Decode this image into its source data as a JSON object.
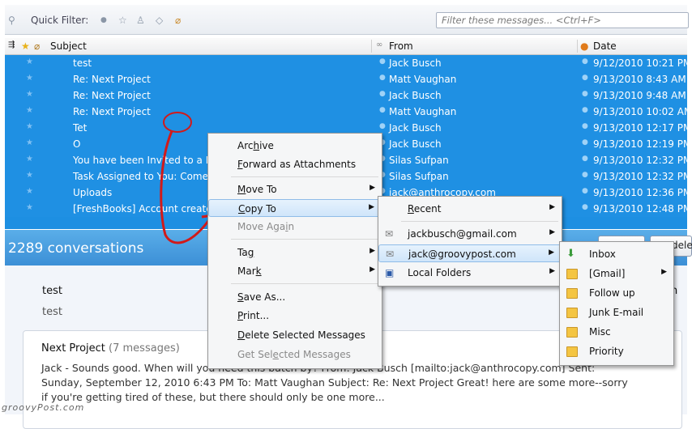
{
  "quick_filter": {
    "label": "Quick Filter:",
    "placeholder": "Filter these messages... <Ctrl+F>",
    "icons": [
      "pin-icon",
      "unread-icon",
      "star-icon",
      "contact-icon",
      "tag-icon",
      "attachment-icon"
    ]
  },
  "columns": {
    "subject": "Subject",
    "from": "From",
    "date": "Date"
  },
  "messages": [
    {
      "subject": "test",
      "from": "Jack Busch",
      "date": "9/12/2010 10:21 PM"
    },
    {
      "subject": "Re: Next Project",
      "from": "Matt Vaughan",
      "date": "9/13/2010 8:43 AM"
    },
    {
      "subject": "Re: Next Project",
      "from": "Jack Busch",
      "date": "9/13/2010 9:48 AM"
    },
    {
      "subject": "Re: Next Project",
      "from": "Matt Vaughan",
      "date": "9/13/2010 10:02 AM"
    },
    {
      "subject": "Tet",
      "from": "Jack Busch",
      "date": "9/13/2010 12:17 PM"
    },
    {
      "subject": "O",
      "from": "Jack Busch",
      "date": "9/13/2010 12:19 PM"
    },
    {
      "subject": "You have been Invited to a P",
      "from": "Silas Sufpan",
      "date": "9/13/2010 12:32 PM"
    },
    {
      "subject": "Task Assigned to You: Come",
      "from": "Silas Sufpan",
      "date": "9/13/2010 12:32 PM"
    },
    {
      "subject": "Uploads",
      "from": "jack@anthrocopy.com",
      "date": "9/13/2010 12:36 PM"
    },
    {
      "subject": "[FreshBooks] Account create",
      "from": "Jack Busch",
      "date": "9/13/2010 12:48 PM"
    }
  ],
  "conversation": {
    "count_label": "2289 conversations",
    "button_fragment": "delet"
  },
  "preview": {
    "subject1": "test",
    "body1": "test",
    "trailing_letter": "h",
    "thread_title": "Next Project",
    "thread_count": "(7 messages)",
    "lines": [
      "Jack - Sounds good. When will you need this batch by? From: Jack Busch [mailto:jack@anthrocopy.com] Sent:",
      "Sunday, September 12, 2010 6:43 PM To: Matt Vaughan Subject: Re: Next Project Great! here are some more--sorry",
      "if you're getting tired of these, but there should only be one more..."
    ]
  },
  "context_menu": {
    "archive": {
      "pre": "Arc",
      "u": "h",
      "post": "ive"
    },
    "forward": {
      "pre": "",
      "u": "F",
      "post": "orward as Attachments"
    },
    "move_to": {
      "pre": "",
      "u": "M",
      "post": "ove To"
    },
    "copy_to": {
      "pre": "",
      "u": "C",
      "post": "opy To"
    },
    "move_again": {
      "pre": "Move Aga",
      "u": "i",
      "post": "n"
    },
    "tag": {
      "pre": "Ta",
      "u": "g",
      "post": ""
    },
    "mark": {
      "pre": "Mar",
      "u": "k",
      "post": ""
    },
    "save_as": {
      "pre": "",
      "u": "S",
      "post": "ave As..."
    },
    "print": {
      "pre": "",
      "u": "P",
      "post": "rint..."
    },
    "delete": {
      "pre": "",
      "u": "D",
      "post": "elete Selected Messages"
    },
    "get_selected": {
      "pre": "Get Sel",
      "u": "e",
      "post": "cted Messages"
    }
  },
  "copy_submenu": {
    "recent": {
      "pre": "",
      "u": "R",
      "post": "ecent"
    },
    "accounts": [
      "jackbusch@gmail.com",
      "jack@groovypost.com"
    ],
    "local_folders": "Local Folders"
  },
  "folder_submenu": [
    "Inbox",
    "[Gmail]",
    "Follow up",
    "Junk E-mail",
    "Misc",
    "Priority"
  ],
  "watermark": "groovyPost.com"
}
